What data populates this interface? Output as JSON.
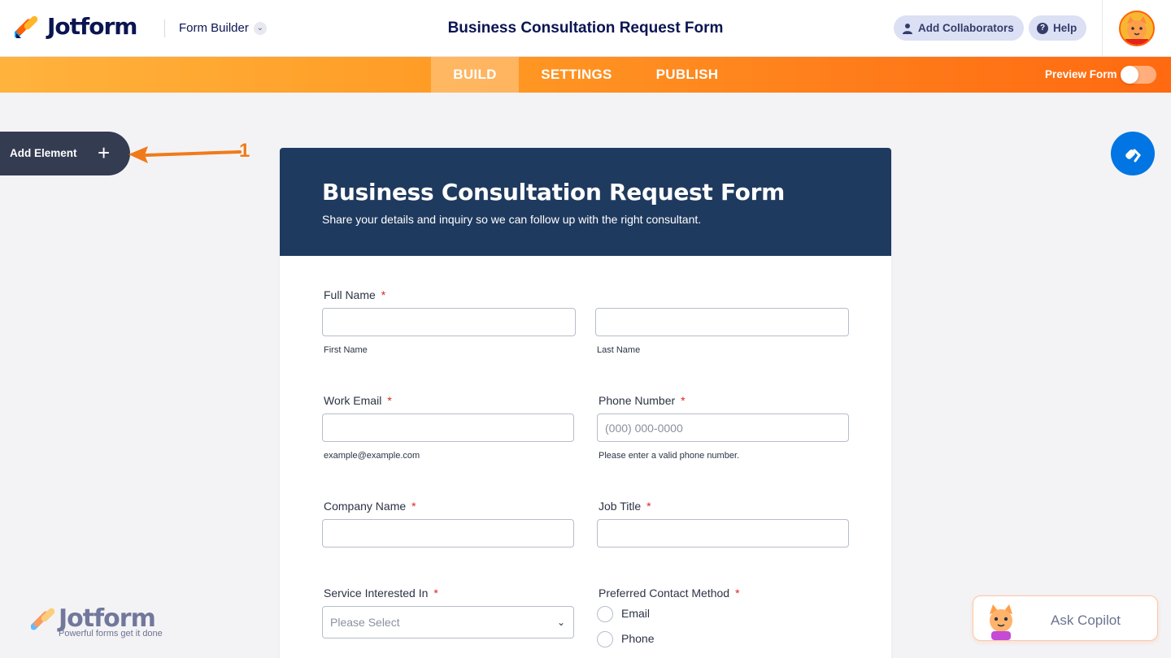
{
  "header": {
    "brand": "Jotform",
    "mode_label": "Form Builder",
    "title": "Business Consultation Request Form",
    "add_collaborators": "Add Collaborators",
    "help": "Help"
  },
  "nav": {
    "tabs": [
      "BUILD",
      "SETTINGS",
      "PUBLISH"
    ],
    "active_tab": "BUILD",
    "preview_label": "Preview Form",
    "preview_on": false
  },
  "sidebar": {
    "add_element": "Add Element",
    "annotation_number": "1"
  },
  "form": {
    "title": "Business Consultation Request Form",
    "subtitle": "Share your details and inquiry so we can follow up with the right consultant.",
    "required_mark": "*",
    "full_name": {
      "label": "Full Name",
      "first_sub": "First Name",
      "last_sub": "Last Name"
    },
    "work_email": {
      "label": "Work Email",
      "sub": "example@example.com"
    },
    "phone": {
      "label": "Phone Number",
      "placeholder": "(000) 000-0000",
      "sub": "Please enter a valid phone number."
    },
    "company": {
      "label": "Company Name"
    },
    "job_title": {
      "label": "Job Title"
    },
    "service": {
      "label": "Service Interested In",
      "placeholder": "Please Select"
    },
    "contact_method": {
      "label": "Preferred Contact Method",
      "options": [
        "Email",
        "Phone"
      ]
    }
  },
  "footer_brand": {
    "name": "Jotform",
    "tagline": "Powerful forms get it done"
  },
  "copilot": {
    "label": "Ask Copilot"
  },
  "colors": {
    "brand_navy": "#0a1551",
    "orange": "#ff7b1a",
    "form_header": "#1f3a5f",
    "required": "#e2231a",
    "accent_blue": "#0075e3"
  }
}
